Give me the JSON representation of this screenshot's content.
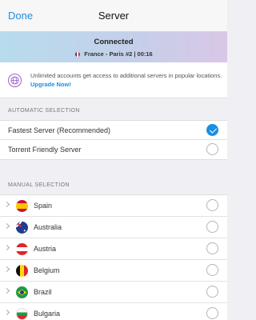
{
  "nav": {
    "done_label": "Done",
    "title": "Server"
  },
  "status": {
    "title": "Connected",
    "location": "France - Paris #2 | 00:16"
  },
  "promo": {
    "text": "Unlimited accounts get access to additional servers in popular locations.",
    "link": "Upgrade Now!"
  },
  "automatic": {
    "header": "AUTOMATIC SELECTION",
    "items": [
      {
        "label": "Fastest Server (Recommended)",
        "selected": true
      },
      {
        "label": "Torrent Friendly Server",
        "selected": false
      }
    ]
  },
  "manual": {
    "header": "MANUAL SELECTION",
    "items": [
      {
        "label": "Spain",
        "flag": "spain-flag-icon"
      },
      {
        "label": "Australia",
        "flag": "australia-flag-icon"
      },
      {
        "label": "Austria",
        "flag": "austria-flag-icon"
      },
      {
        "label": "Belgium",
        "flag": "belgium-flag-icon"
      },
      {
        "label": "Brazil",
        "flag": "brazil-flag-icon"
      },
      {
        "label": "Bulgaria",
        "flag": "bulgaria-flag-icon"
      }
    ]
  },
  "colors": {
    "accent": "#1a8fe3",
    "promo_icon": "#9a62c7"
  }
}
